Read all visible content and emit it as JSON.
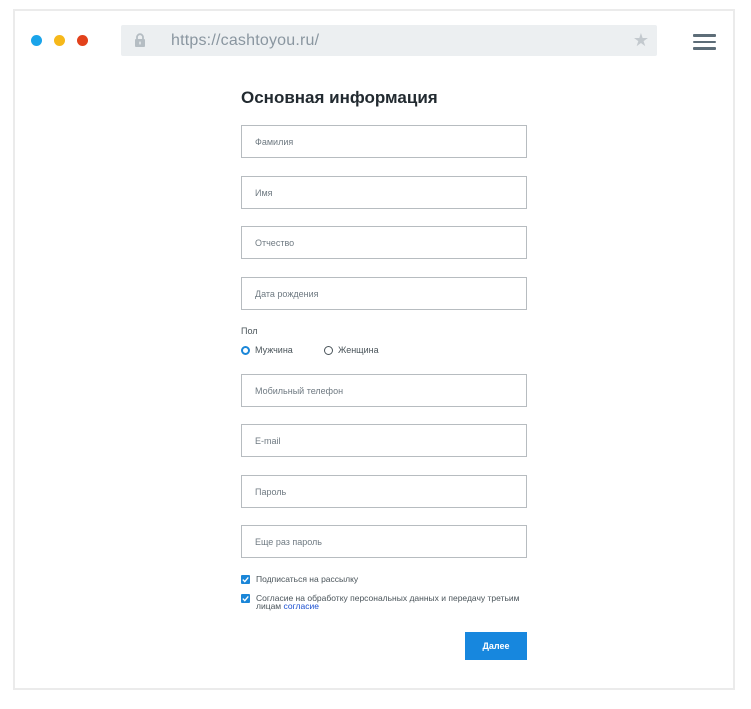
{
  "browser": {
    "url": "https://cashtoyou.ru/",
    "lock_icon": "lock-icon",
    "bookmark_icon": "star-icon",
    "menu_icon": "hamburger-menu-icon",
    "window_controls": [
      "#1aa4ea",
      "#f6b81a",
      "#e2411b"
    ]
  },
  "form": {
    "title": "Основная информация",
    "fields": {
      "last_name": {
        "placeholder": "Фамилия",
        "value": ""
      },
      "first_name": {
        "placeholder": "Имя",
        "value": ""
      },
      "middle_name": {
        "placeholder": "Отчество",
        "value": ""
      },
      "birth_date": {
        "placeholder": "Дата рождения",
        "value": ""
      },
      "phone": {
        "placeholder": "Мобильный телефон",
        "value": ""
      },
      "email": {
        "placeholder": "E-mail",
        "value": ""
      },
      "password": {
        "placeholder": "Пароль",
        "value": ""
      },
      "password_repeat": {
        "placeholder": "Еще раз пароль",
        "value": ""
      }
    },
    "gender": {
      "label": "Пол",
      "options": [
        {
          "label": "Мужчина",
          "selected": true
        },
        {
          "label": "Женщина",
          "selected": false
        }
      ]
    },
    "checkboxes": {
      "newsletter": {
        "label": "Подписаться на рассылку",
        "checked": true
      },
      "consent": {
        "label": "Согласие на обработку персональных данных и передачу третьим лицам",
        "link_text": "согласие",
        "checked": true
      }
    },
    "submit_label": "Далее",
    "accent_color": "#1787de"
  }
}
